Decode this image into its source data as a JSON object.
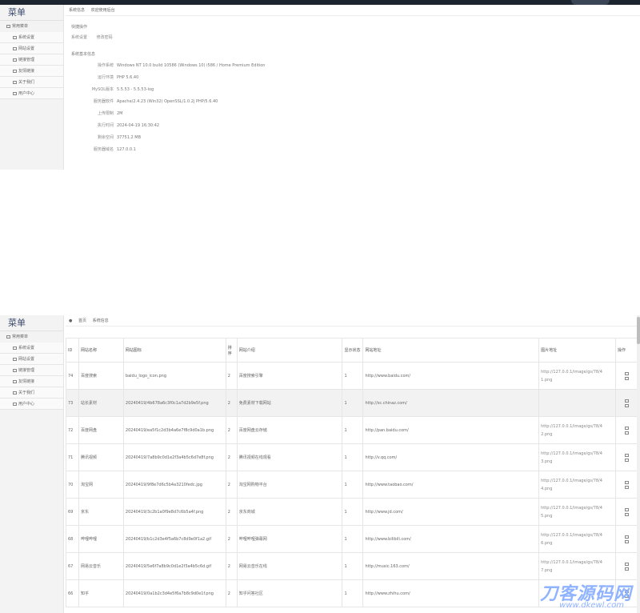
{
  "panel1": {
    "sidebar": {
      "title": "菜单",
      "group": "常用菜单",
      "items": [
        "系统设置",
        "网站设置",
        "链接管理",
        "友情链接",
        "关于我们",
        "用户中心"
      ]
    },
    "breadcrumb": [
      "系统信息",
      "欢迎使用后台"
    ],
    "quick_title": "快捷操作",
    "shortcuts": [
      "系统设置",
      "修改密码"
    ],
    "server_title": "系统基本信息",
    "info": [
      {
        "label": "操作系统",
        "value": "Windows NT 10.0 build 10586 (Windows 10) i586 / Home Premium Edition"
      },
      {
        "label": "运行环境",
        "value": "PHP 5.6.40"
      },
      {
        "label": "MySQL版本",
        "value": "5.5.53 - 5.5.53-log"
      },
      {
        "label": "服务器软件",
        "value": "Apache/2.4.23 (Win32) OpenSSL/1.0.2j PHP/5.6.40"
      },
      {
        "label": "上传限制",
        "value": "2M"
      },
      {
        "label": "执行时间",
        "value": "2024-04-19 16:30:42"
      },
      {
        "label": "剩余空间",
        "value": "37751.2 MB"
      },
      {
        "label": "服务器域名",
        "value": "127.0.0.1"
      }
    ]
  },
  "panel2": {
    "sidebar": {
      "title": "菜单",
      "group": "常用菜单",
      "items": [
        "系统设置",
        "网站设置",
        "链接管理",
        "友情链接",
        "关于我们",
        "用户中心"
      ]
    },
    "breadcrumb": [
      "首页",
      "系统信息"
    ],
    "table": {
      "headers": [
        "ID",
        "网站名称",
        "网站图标",
        "排序",
        "网站介绍",
        "显示状态",
        "网站地址",
        "图片地址",
        "操作"
      ],
      "rows": [
        {
          "id": "74",
          "name": "百度搜索",
          "icon": "baidu_logo_icon.png",
          "sort": "2",
          "desc": "百度搜索引擎",
          "status": "1",
          "url": "http://www.baidu.com/",
          "img1": "http://127.0.0.1/image/gs/78/4",
          "img2": "1.png"
        },
        {
          "id": "73",
          "name": "站长素材",
          "icon": "20240419/4b678a6c3f0c1a7d2b9e5f.png",
          "sort": "2",
          "desc": "免费素材下载网站",
          "status": "1",
          "url": "http://sc.chinaz.com/",
          "img1": "",
          "img2": ""
        },
        {
          "id": "72",
          "name": "百度网盘",
          "icon": "20240419/ea5f1c2d3b4a6e7f8c9d0a1b.png",
          "sort": "2",
          "desc": "百度网盘云存储",
          "status": "1",
          "url": "http://pan.baidu.com/",
          "img1": "http://127.0.0.1/image/gs/78/4",
          "img2": "2.png"
        },
        {
          "id": "71",
          "name": "腾讯视频",
          "icon": "20240419/7a8b9c0d1e2f3a4b5c6d7e8f.png",
          "sort": "2",
          "desc": "腾讯视频在线观看",
          "status": "1",
          "url": "http://v.qq.com/",
          "img1": "http://127.0.0.1/image/gs/78/4",
          "img2": "3.png"
        },
        {
          "id": "70",
          "name": "淘宝网",
          "icon": "20240419/9f8e7d6c5b4a3210fedc.jpg",
          "sort": "2",
          "desc": "淘宝网购物平台",
          "status": "1",
          "url": "http://www.taobao.com/",
          "img1": "http://127.0.0.1/image/gs/78/4",
          "img2": "4.png"
        },
        {
          "id": "69",
          "name": "京东",
          "icon": "20240419/3c2b1a0f9e8d7c6b5a4f.png",
          "sort": "2",
          "desc": "京东商城",
          "status": "1",
          "url": "http://www.jd.com/",
          "img1": "http://127.0.0.1/image/gs/78/4",
          "img2": "5.png"
        },
        {
          "id": "68",
          "name": "哔哩哔哩",
          "icon": "20240419/b1c2d3e4f5a6b7c8d9e0f1a2.gif",
          "sort": "2",
          "desc": "哔哩哔哩弹幕网",
          "status": "1",
          "url": "http://www.bilibili.com/",
          "img1": "http://127.0.0.1/image/gs/78/4",
          "img2": "6.png"
        },
        {
          "id": "67",
          "name": "网易云音乐",
          "icon": "20240419/5e6f7a8b9c0d1e2f3a4b5c6d.gif",
          "sort": "2",
          "desc": "网易云音乐在线",
          "status": "1",
          "url": "http://music.163.com/",
          "img1": "http://127.0.0.1/image/gs/78/4",
          "img2": "7.png"
        },
        {
          "id": "66",
          "name": "知乎",
          "icon": "20240419/0a1b2c3d4e5f6a7b8c9d0e1f.png",
          "sort": "2",
          "desc": "知乎问答社区",
          "status": "1",
          "url": "http://www.zhihu.com/",
          "img1": "",
          "img2": ""
        }
      ]
    },
    "watermark": {
      "big": "刀客源码网",
      "small": "www.dkewl.com"
    }
  }
}
